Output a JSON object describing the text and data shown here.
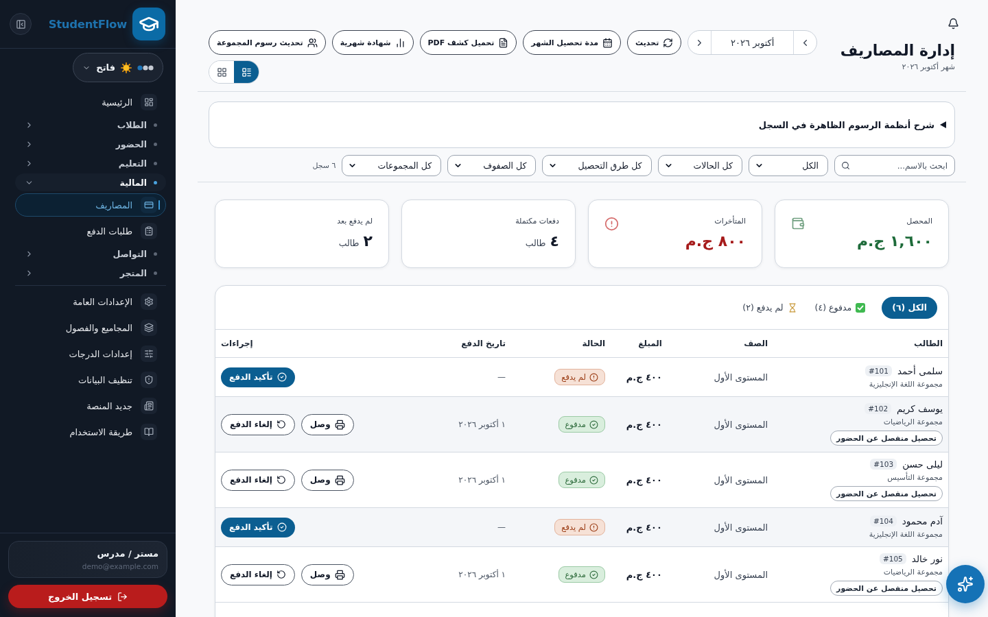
{
  "sidebar": {
    "brand": "StudentFlow",
    "theme": {
      "label": "فاتح"
    },
    "nav": [
      {
        "kind": "link",
        "label": "الرئيسية",
        "selected": false
      },
      {
        "kind": "group",
        "label": "الطلاب",
        "expanded": false
      },
      {
        "kind": "group",
        "label": "الحضور",
        "expanded": false
      },
      {
        "kind": "group",
        "label": "التعليم",
        "expanded": false
      },
      {
        "kind": "group",
        "label": "المالية",
        "expanded": true,
        "children": [
          {
            "label": "المصاريف",
            "selected": true
          },
          {
            "label": "طلبات الدفع",
            "selected": false
          }
        ]
      },
      {
        "kind": "group",
        "label": "التواصل",
        "expanded": false
      },
      {
        "kind": "group",
        "label": "المتجر",
        "expanded": false
      }
    ],
    "settings": [
      {
        "label": "الإعدادات العامة",
        "selected": false
      },
      {
        "label": "المجاميع والفصول",
        "selected": false
      },
      {
        "label": "إعدادات الدرجات",
        "selected": false
      },
      {
        "label": "تنظيف البيانات",
        "selected": false
      },
      {
        "label": "جديد المنصة",
        "selected": false
      },
      {
        "label": "طريقة الاستخدام",
        "selected": false
      }
    ],
    "user": {
      "name": "مستر / مدرس",
      "email": "demo@example.com"
    },
    "logout": "تسجيل الخروج"
  },
  "header": {
    "title": "إدارة المصاريف",
    "subtitle": "شهر أكتوبر ٢٠٢٦",
    "month": "أكتوبر ٢٠٢٦",
    "actions": [
      "تحديث",
      "مدة تحصيل الشهر",
      "تحميل كشف PDF",
      "شهادة شهرية",
      "تحديث رسوم المجموعة"
    ],
    "view_modes": [
      {
        "kind": "list",
        "selected": true
      },
      {
        "kind": "grid",
        "selected": false
      }
    ]
  },
  "info_panel": {
    "title": "شرح أنظمة الرسوم الظاهرة في السجل",
    "expanded": false
  },
  "filters": {
    "search": {
      "placeholder": "ابحث بالاسم..."
    },
    "selects": [
      "الكل",
      "كل الحالات",
      "كل طرق التحصيل",
      "كل الصفوف",
      "كل المجموعات"
    ],
    "count": "٦ سجل"
  },
  "stats": [
    {
      "kind": "collected",
      "label": "المحصل",
      "value": "١,٦٠٠ ج.م"
    },
    {
      "kind": "overdue",
      "label": "المتأخرات",
      "value": "٨٠٠ ج.م"
    },
    {
      "kind": "count",
      "label": "دفعات مكتملة",
      "value": "٤",
      "unit": "طالب"
    },
    {
      "kind": "count",
      "label": "لم يدفع بعد",
      "value": "٢",
      "unit": "طالب"
    }
  ],
  "table": {
    "tabs": [
      {
        "kind": "all",
        "label": "الكل (٦)",
        "selected": true
      },
      {
        "kind": "paid",
        "label": "مدفوع (٤)",
        "selected": false
      },
      {
        "kind": "unpaid",
        "label": "لم يدفع (٢)",
        "selected": false
      }
    ],
    "columns": [
      "الطالب",
      "الصف",
      "المبلغ",
      "الحالة",
      "تاريخ الدفع",
      "إجراءات"
    ],
    "rows": [
      {
        "name": "سلمى أحمد",
        "id": "#101",
        "group": "مجموعة اللغة الإنجليزية",
        "class": "المستوى الأول",
        "amount": "٤٠٠ ج.م",
        "paid": false,
        "status_label": "لم يدفع",
        "date": "—",
        "actions": [
          {
            "kind": "confirm",
            "label": "تأكيد الدفع"
          }
        ]
      },
      {
        "name": "يوسف كريم",
        "id": "#102",
        "group": "مجموعة الرياضيات",
        "tag": "تحصيل منفصل عن الحضور",
        "class": "المستوى الأول",
        "amount": "٤٠٠ ج.م",
        "paid": true,
        "status_label": "مدفوع",
        "date": "١ أكتوبر ٢٠٢٦",
        "actions": [
          {
            "kind": "receipt",
            "label": "وصل"
          },
          {
            "kind": "undo",
            "label": "إلغاء الدفع"
          }
        ]
      },
      {
        "name": "ليلى حسن",
        "id": "#103",
        "group": "مجموعة التأسيس",
        "tag": "تحصيل منفصل عن الحضور",
        "class": "المستوى الأول",
        "amount": "٤٠٠ ج.م",
        "paid": true,
        "status_label": "مدفوع",
        "date": "١ أكتوبر ٢٠٢٦",
        "actions": [
          {
            "kind": "receipt",
            "label": "وصل"
          },
          {
            "kind": "undo",
            "label": "إلغاء الدفع"
          }
        ]
      },
      {
        "name": "آدم محمود",
        "id": "#104",
        "group": "مجموعة اللغة الإنجليزية",
        "class": "المستوى الأول",
        "amount": "٤٠٠ ج.م",
        "paid": false,
        "status_label": "لم يدفع",
        "date": "—",
        "actions": [
          {
            "kind": "confirm",
            "label": "تأكيد الدفع"
          }
        ]
      },
      {
        "name": "نور خالد",
        "id": "#105",
        "group": "مجموعة الرياضيات",
        "tag": "تحصيل منفصل عن الحضور",
        "class": "المستوى الأول",
        "amount": "٤٠٠ ج.م",
        "paid": true,
        "status_label": "مدفوع",
        "date": "١ أكتوبر ٢٠٢٦",
        "actions": [
          {
            "kind": "receipt",
            "label": "وصل"
          },
          {
            "kind": "undo",
            "label": "إلغاء الدفع"
          }
        ]
      }
    ]
  }
}
